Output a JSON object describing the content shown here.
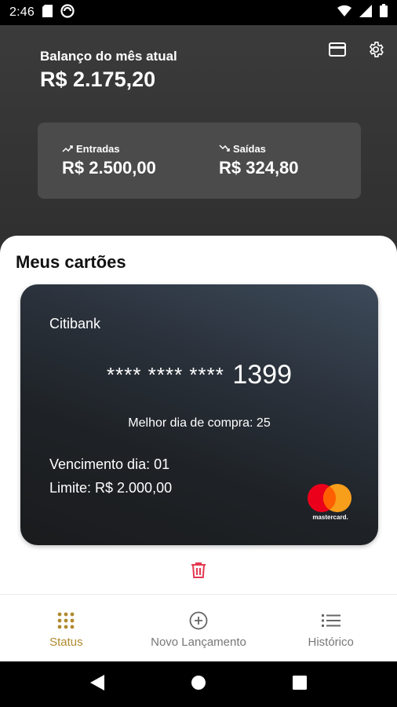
{
  "status_bar": {
    "time": "2:46",
    "icons": [
      "sd-card-icon",
      "vpn-icon",
      "wifi-icon",
      "signal-icon",
      "battery-icon"
    ]
  },
  "header": {
    "balance_label": "Balanço do mês atual",
    "balance_value": "R$ 2.175,20",
    "actions": [
      "card-icon",
      "gear-icon"
    ],
    "summary": {
      "income_label": "Entradas",
      "income_value": "R$ 2.500,00",
      "expense_label": "Saídas",
      "expense_value": "R$ 324,80"
    }
  },
  "cards_section": {
    "title": "Meus cartões",
    "card": {
      "bank": "Citibank",
      "number_mask": "**** **** ****",
      "number_last": "1399",
      "best_day": "Melhor dia de compra: 25",
      "due_day": "Vencimento dia: 01",
      "limit": "Limite: R$ 2.000,00",
      "brand": "mastercard."
    },
    "delete_icon": "trash-icon"
  },
  "bottom_nav": {
    "items": [
      {
        "label": "Status",
        "icon": "grid-dots-icon",
        "active": true
      },
      {
        "label": "Novo Lançamento",
        "icon": "plus-circle-icon",
        "active": false
      },
      {
        "label": "Histórico",
        "icon": "list-icon",
        "active": false
      }
    ]
  },
  "colors": {
    "accent": "#b08a2e",
    "danger": "#e53950",
    "header_bg": "#3a3a3a",
    "summary_bg": "#4b4b4b"
  }
}
